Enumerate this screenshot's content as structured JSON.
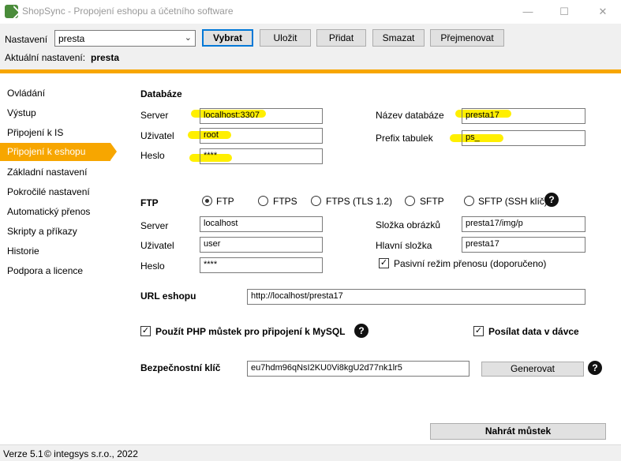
{
  "window": {
    "title": "ShopSync - Propojení eshopu a účetního software",
    "min": "—",
    "max": "☐",
    "close": "✕"
  },
  "settings": {
    "label": "Nastavení",
    "selected": "presta",
    "current_label": "Aktuální nastavení:",
    "current_value": "presta",
    "buttons": {
      "select": "Vybrat",
      "save": "Uložit",
      "add": "Přidat",
      "delete": "Smazat",
      "rename": "Přejmenovat"
    }
  },
  "sidebar": {
    "items": [
      {
        "label": "Ovládání"
      },
      {
        "label": "Výstup"
      },
      {
        "label": "Připojení k IS"
      },
      {
        "label": "Připojení k eshopu"
      },
      {
        "label": "Základní nastavení"
      },
      {
        "label": "Pokročilé nastavení"
      },
      {
        "label": "Automatický přenos"
      },
      {
        "label": "Skripty a příkazy"
      },
      {
        "label": "Historie"
      },
      {
        "label": "Podpora a licence"
      }
    ],
    "active_index": 3
  },
  "database": {
    "title": "Databáze",
    "server_label": "Server",
    "server": "localhost:3307",
    "user_label": "Uživatel",
    "user": "root",
    "password_label": "Heslo",
    "password": "****",
    "dbname_label": "Název databáze",
    "dbname": "presta17",
    "prefix_label": "Prefix tabulek",
    "prefix": "ps_"
  },
  "ftp": {
    "title": "FTP",
    "modes": [
      "FTP",
      "FTPS",
      "FTPS (TLS 1.2)",
      "SFTP",
      "SFTP (SSH klíč)"
    ],
    "selected_mode": "FTP",
    "server_label": "Server",
    "server": "localhost",
    "user_label": "Uživatel",
    "user": "user",
    "password_label": "Heslo",
    "password": "****",
    "images_label": "Složka obrázků",
    "images": "presta17/img/p",
    "main_label": "Hlavní složka",
    "main": "presta17",
    "passive_label": "Pasivní režim přenosu (doporučeno)",
    "passive": true,
    "help": "?"
  },
  "url": {
    "label": "URL eshopu",
    "value": "http://localhost/presta17"
  },
  "options": {
    "php_bridge_label": "Použít PHP můstek pro připojení k MySQL",
    "php_bridge": true,
    "batch_label": "Posílat data v dávce",
    "batch": true,
    "help": "?"
  },
  "security": {
    "label": "Bezpečnostní klíč",
    "value": "eu7hdm96qNsI2KU0Vi8kgU2d77nk1lr5",
    "generate": "Generovat",
    "help": "?"
  },
  "upload_button": "Nahrát můstek",
  "status": {
    "version": "Verze 5.1",
    "copyright": "© integsys s.r.o., 2022"
  },
  "colors": {
    "accent": "#f7a600",
    "highlight": "#ffef00",
    "focus": "#0078d7"
  }
}
